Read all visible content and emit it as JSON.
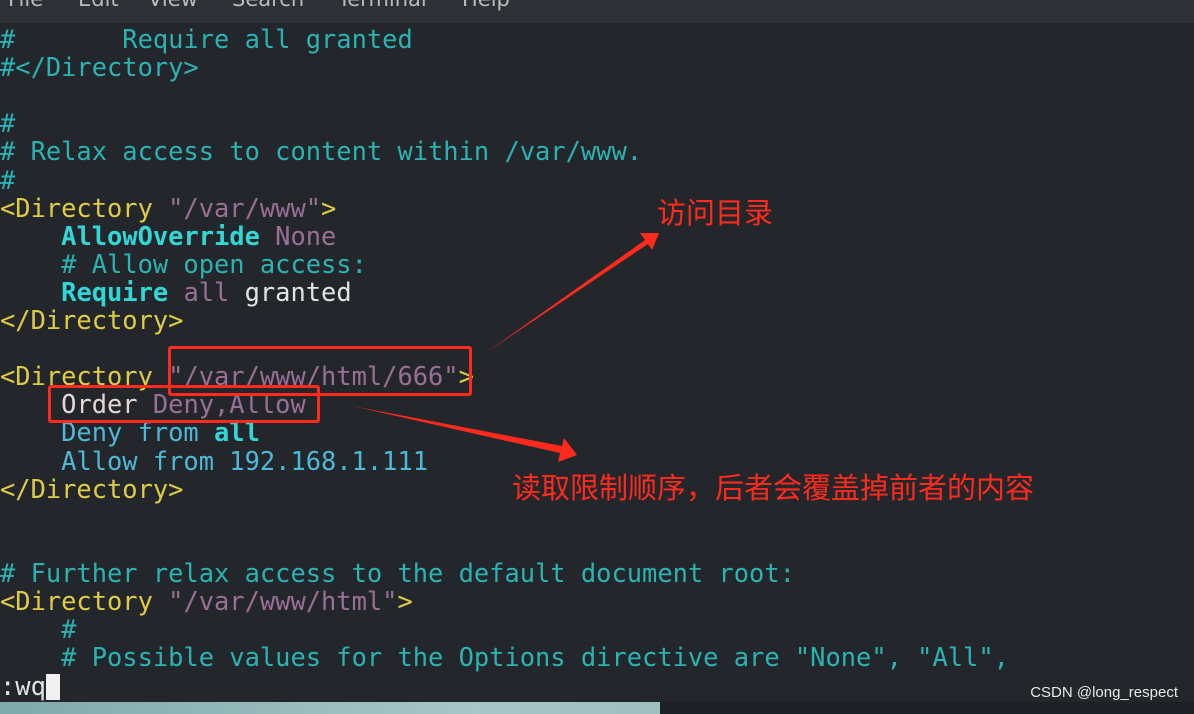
{
  "menu": [
    "File",
    "Edit",
    "View",
    "Search",
    "Terminal",
    "Help"
  ],
  "lines": [
    [
      [
        "c",
        "#       Require all granted"
      ]
    ],
    [
      [
        "c",
        "#</Directory>"
      ]
    ],
    [],
    [
      [
        "c",
        "#"
      ]
    ],
    [
      [
        "c",
        "# Relax access to content within /var/www."
      ]
    ],
    [
      [
        "c",
        "#"
      ]
    ],
    [
      [
        "t",
        "<Directory "
      ],
      [
        "s",
        "\"/var/www\""
      ],
      [
        "t",
        ">"
      ]
    ],
    [
      [
        "p",
        "    "
      ],
      [
        "k",
        "AllowOverride"
      ],
      [
        "s",
        " None"
      ]
    ],
    [
      [
        "c",
        "    # Allow open access:"
      ]
    ],
    [
      [
        "p",
        "    "
      ],
      [
        "k",
        "Require"
      ],
      [
        "s",
        " all"
      ],
      [
        "p",
        " granted"
      ]
    ],
    [
      [
        "t",
        "</Directory>"
      ]
    ],
    [],
    [
      [
        "t",
        "<Directory "
      ],
      [
        "s",
        "\"/var/www/html/666\""
      ],
      [
        "t",
        ">"
      ]
    ],
    [
      [
        "p",
        "    "
      ],
      [
        "o",
        "Order"
      ],
      [
        "s",
        " Deny,Allow"
      ]
    ],
    [
      [
        "d",
        "    Deny from "
      ],
      [
        "k",
        "all"
      ]
    ],
    [
      [
        "d",
        "    Allow from 192.168.1.111"
      ]
    ],
    [
      [
        "t",
        "</Directory>"
      ]
    ],
    [],
    [],
    [
      [
        "c",
        "# Further relax access to the default document root:"
      ]
    ],
    [
      [
        "t",
        "<Directory "
      ],
      [
        "s",
        "\"/var/www/html\""
      ],
      [
        "t",
        ">"
      ]
    ],
    [
      [
        "c",
        "    #"
      ]
    ],
    [
      [
        "c",
        "    # Possible values for the Options directive are \"None\", \"All\","
      ]
    ]
  ],
  "command": ":wq",
  "annotations": {
    "directory_note": "访问目录",
    "order_note": "读取限制顺序，后者会覆盖掉前者的内容"
  },
  "watermark": "CSDN @long_respect",
  "colors": {
    "annotation": "#ff2a1c",
    "comment": "#2bb3b3",
    "tag": "#e0cc44",
    "string": "#9a6f96",
    "keyword": "#33d6d6"
  }
}
